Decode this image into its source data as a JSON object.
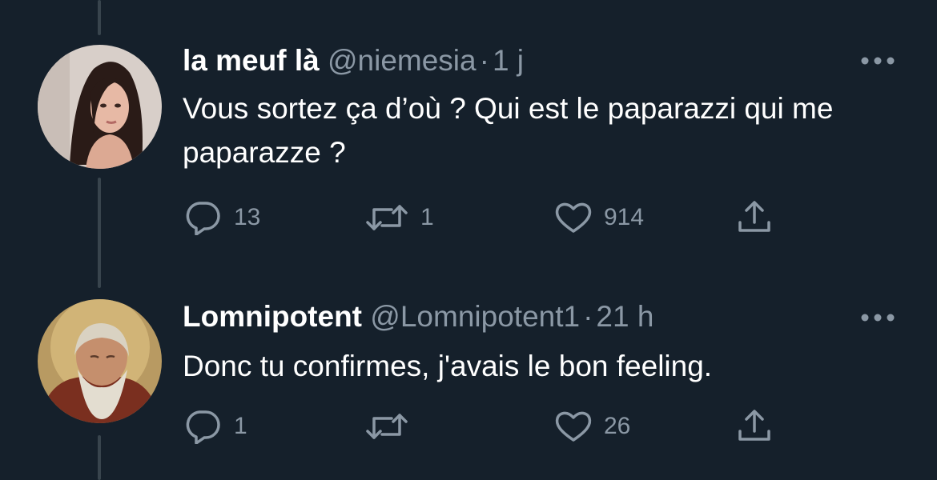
{
  "tweets": [
    {
      "display_name": "la meuf là",
      "handle": "@niemesia",
      "separator": "·",
      "time": "1 j",
      "text": "Vous sortez ça d’où ? Qui est le paparazzi qui me paparazze ?",
      "reply_count": "13",
      "retweet_count": "1",
      "like_count": "914"
    },
    {
      "display_name": "Lomnipotent",
      "handle": "@Lomnipotent1",
      "separator": "·",
      "time": "21 h",
      "text": "Donc tu confirmes, j'avais le bon feeling.",
      "reply_count": "1",
      "retweet_count": "",
      "like_count": "26"
    }
  ],
  "colors": {
    "background": "#15202b",
    "primary_text": "#ffffff",
    "secondary_text": "#8b98a5",
    "thread_line": "#38444d"
  },
  "icons": [
    "reply-icon",
    "retweet-icon",
    "like-icon",
    "share-icon",
    "more-icon"
  ]
}
